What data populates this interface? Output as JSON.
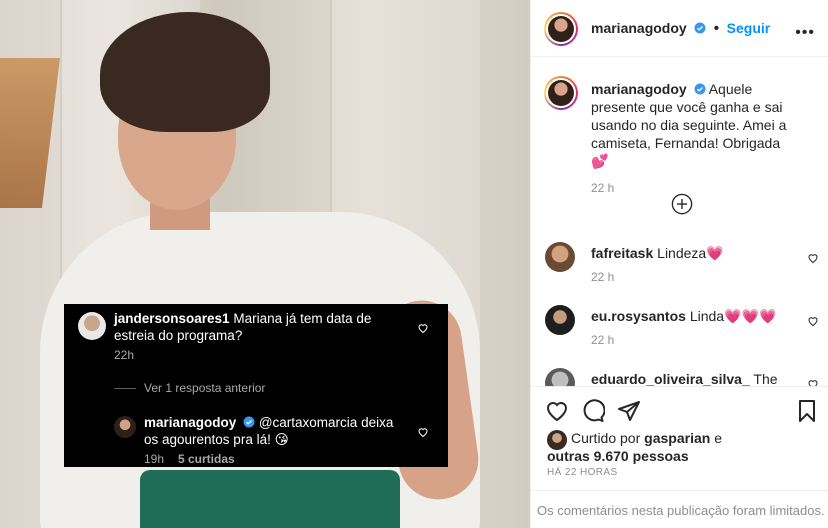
{
  "overlay": {
    "comment1": {
      "user": "jandersonsoares1",
      "text_line1": "Mariana já tem data de",
      "text_line2": "estreia do programa?",
      "time": "22h"
    },
    "view_replies": "Ver 1 resposta anterior",
    "reply": {
      "user": "marianagodoy",
      "mention": "@cartaxomarcia",
      "text_line1": "deixa",
      "text_line2": "os agourentos pra lá! 😘",
      "time": "19h",
      "likes": "5 curtidas"
    }
  },
  "header": {
    "username": "marianagodoy",
    "separator": "•",
    "follow_label": "Seguir",
    "more_label": "•••"
  },
  "caption": {
    "username": "marianagodoy",
    "text": "Aquele presente que você ganha e sai usando no dia seguinte. Amei a camiseta, Fernanda! Obrigada💕",
    "time": "22 h"
  },
  "comments": [
    {
      "user": "fafreitask",
      "text": "Lindeza💗",
      "time": "22 h"
    },
    {
      "user": "eu.rosysantos",
      "text": "Linda💗💗💗",
      "time": "22 h"
    },
    {
      "user": "eduardo_oliveira_silva_",
      "text": "The",
      "time": ""
    }
  ],
  "likes": {
    "prefix": "Curtido por",
    "liker": "gasparian",
    "middle": "e",
    "others": "outras 9.670 pessoas"
  },
  "posted_ago": "HÁ 22 HORAS",
  "comments_limited": "Os comentários nesta publicação foram limitados.",
  "colors": {
    "link_blue": "#0095f6",
    "verified_blue": "#3897f0",
    "secondary_text": "#8e8e8e"
  }
}
